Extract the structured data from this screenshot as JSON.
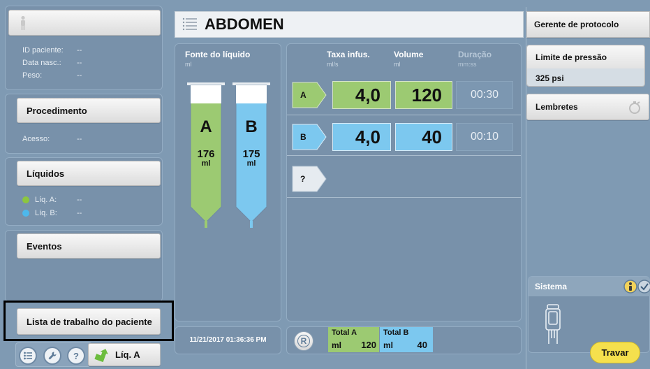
{
  "header": {
    "title": "ABDOMEN"
  },
  "sidebar": {
    "patient_info": [
      {
        "label": "ID paciente:",
        "value": "--"
      },
      {
        "label": "Data nasc.:",
        "value": "--"
      },
      {
        "label": "Peso:",
        "value": "--"
      }
    ],
    "procedure_label": "Procedimento",
    "access": {
      "label": "Acesso:",
      "value": "--"
    },
    "liquids_label": "Líquidos",
    "liquids": [
      {
        "label": "Líq. A:",
        "value": "--",
        "color": "#8cc63f"
      },
      {
        "label": "Líq. B:",
        "value": "--",
        "color": "#4db8ec"
      }
    ],
    "events_label": "Eventos",
    "worklist_label": "Lista de trabalho do paciente",
    "liq_button_label": "Líq. A"
  },
  "fluid_source": {
    "title": "Fonte do líquido",
    "unit": "ml",
    "syringes": [
      {
        "letter": "A",
        "volume": "176",
        "unit": "ml",
        "color": "#9cca72"
      },
      {
        "letter": "B",
        "volume": "175",
        "unit": "ml",
        "color": "#7cc8ef"
      }
    ],
    "timestamp": "11/21/2017 01:36:36 PM"
  },
  "phases": {
    "headers": [
      {
        "title": "Taxa infus.",
        "unit": "ml/s"
      },
      {
        "title": "Volume",
        "unit": "ml"
      },
      {
        "title": "Duração",
        "unit": "mm:ss"
      }
    ],
    "rows": [
      {
        "tag": "A",
        "rate": "4,0",
        "volume": "120",
        "duration": "00:30"
      },
      {
        "tag": "B",
        "rate": "4,0",
        "volume": "40",
        "duration": "00:10"
      }
    ],
    "add_tag": "?",
    "reset_label": "R",
    "totals": [
      {
        "title": "Total A",
        "unit": "ml",
        "value": "120"
      },
      {
        "title": "Total B",
        "unit": "ml",
        "value": "40"
      }
    ]
  },
  "right": {
    "protocol_manager": "Gerente de protocolo",
    "pressure_label": "Limite de pressão",
    "pressure_value": "325 psi",
    "reminders_label": "Lembretes",
    "system_label": "Sistema",
    "lock_label": "Travar"
  }
}
